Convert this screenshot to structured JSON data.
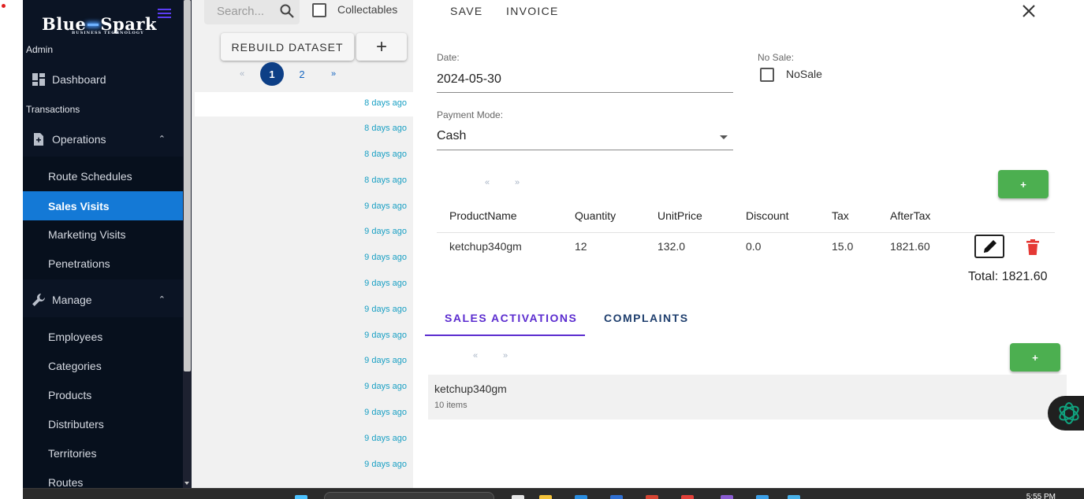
{
  "sidebar": {
    "logo_main_left": "Blue",
    "logo_main_right": "Spark",
    "logo_sub": "BUSINESS   TECHNOLOGY",
    "role": "Admin",
    "dashboard": "Dashboard",
    "section_transactions": "Transactions",
    "operations": "Operations",
    "operations_items": [
      "Route Schedules",
      "Sales Visits",
      "Marketing Visits",
      "Penetrations"
    ],
    "manage": "Manage",
    "manage_items": [
      "Employees",
      "Categories",
      "Products",
      "Distributers",
      "Territories",
      "Routes"
    ]
  },
  "list": {
    "search_placeholder": "Search...",
    "collectables_label": "Collectables",
    "rebuild_label": "REBUILD DATASET",
    "add_label": "+",
    "pagination": {
      "prev": "«",
      "pages": [
        "1",
        "2"
      ],
      "current": "1",
      "next": "»"
    },
    "rows": [
      "8 days ago",
      "8 days ago",
      "8 days ago",
      "8 days ago",
      "9 days ago",
      "9 days ago",
      "9 days ago",
      "9 days ago",
      "9 days ago",
      "9 days ago",
      "9 days ago",
      "9 days ago",
      "9 days ago",
      "9 days ago",
      "9 days ago"
    ]
  },
  "detail": {
    "save_label": "SAVE",
    "invoice_label": "INVOICE",
    "close_label": "✕",
    "date_label": "Date:",
    "date_value": "2024-05-30",
    "nosale_label": "No Sale:",
    "nosale_checkbox_label": "NoSale",
    "payment_label": "Payment Mode:",
    "payment_value": "Cash",
    "items_pager": {
      "prev": "«",
      "next": "»"
    },
    "add_item_label": "+",
    "table_headers": [
      "ProductName",
      "Quantity",
      "UnitPrice",
      "Discount",
      "Tax",
      "AfterTax"
    ],
    "table_rows": [
      {
        "product": "ketchup340gm",
        "quantity": "12",
        "unit_price": "132.0",
        "discount": "0.0",
        "tax": "15.0",
        "after_tax": "1821.60"
      }
    ],
    "total_text": "Total: 1821.60",
    "tabs": [
      "SALES ACTIVATIONS",
      "COMPLAINTS"
    ],
    "active_tab": "SALES ACTIVATIONS",
    "activations_pager": {
      "prev": "«",
      "next": "»"
    },
    "add_activation_label": "+",
    "activation_card": {
      "name": "ketchup340gm",
      "count": "10 items"
    }
  },
  "taskbar": {
    "clock": "5:55 PM"
  },
  "colors": {
    "sidebar_bg": "#0b1424",
    "active_item": "#1479d6",
    "accent_purple": "#5b2ccf",
    "green_button": "#4caf50",
    "pager_current": "#0d3f86",
    "time_text": "#1aa0c4",
    "delete_red": "#e53935"
  }
}
